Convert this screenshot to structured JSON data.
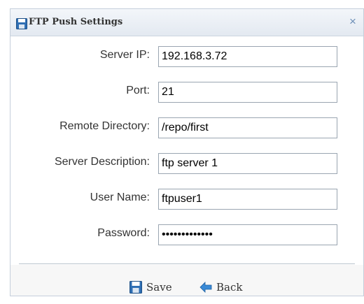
{
  "dialog": {
    "title": "FTP Push Settings",
    "close_glyph": "×",
    "icons": {
      "title": "floppy-disk-icon",
      "close": "close-icon"
    }
  },
  "form": {
    "server_ip": {
      "label": "Server IP:",
      "value": "192.168.3.72"
    },
    "port": {
      "label": "Port:",
      "value": "21"
    },
    "remote_directory": {
      "label": "Remote Directory:",
      "value": "/repo/first"
    },
    "server_description": {
      "label": "Server Description:",
      "value": "ftp server 1"
    },
    "user_name": {
      "label": "User Name:",
      "value": "ftpuser1"
    },
    "password": {
      "label": "Password:",
      "value": "•••••••••••••"
    }
  },
  "footer": {
    "save": {
      "label": "Save",
      "icon": "floppy-disk-icon"
    },
    "back": {
      "label": "Back",
      "icon": "back-arrow-icon"
    }
  },
  "colors": {
    "accent": "#2f6fb4",
    "titlebar": "#e9eef4",
    "border": "#9aa5b1"
  }
}
